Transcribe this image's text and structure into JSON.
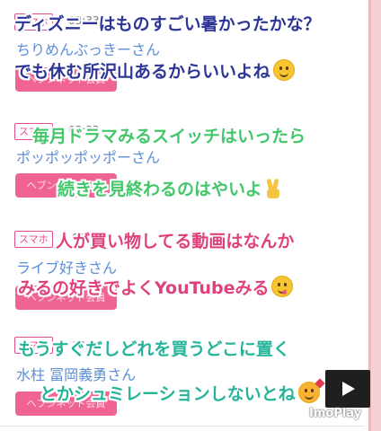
{
  "cards": [
    {
      "tag": "スマホ",
      "time": "03:33",
      "user": "ちりめんぶっきーさん",
      "member_label": "ヘブンネット会員"
    },
    {
      "tag": "スマホ",
      "time": "03:33",
      "user": "ポッポッポッポーさん",
      "member_label": "ヘブンネット会員"
    },
    {
      "tag": "スマホ",
      "time": "03:33",
      "user": "ライブ好きさん",
      "member_label": "ヘブンネット会員"
    },
    {
      "tag": "スマホ",
      "time": "03:33",
      "user": "水柱 冨岡義勇さん",
      "member_label": "ヘブンネット会員"
    }
  ],
  "captions": {
    "c1": "ディズニーはものすごい暑かったかな？",
    "c2": "でも休む所沢山あるからいいよね",
    "c3": "毎月ドラマみるスイッチはいったら",
    "c4": "続きを見終わるのはやいよ",
    "c5": "人が買い物してる動画はなんか",
    "c6": "みるの好きでよくYouTubeみる",
    "c7": "もうすぐだしどれを買うどこに置く",
    "c8": "とかシュミレーションしないとね"
  },
  "icons": {
    "emoji_smile": "smiling-face-icon",
    "emoji_peace": "victory-hand-icon",
    "emoji_yum": "yum-face-icon",
    "emoji_love": "hearts-face-icon",
    "play": "play-icon"
  },
  "watermark": "ImoPlay",
  "colors": {
    "accent": "#f06493",
    "user_name": "#5b8ed6",
    "tag_border": "#e04f8d"
  }
}
